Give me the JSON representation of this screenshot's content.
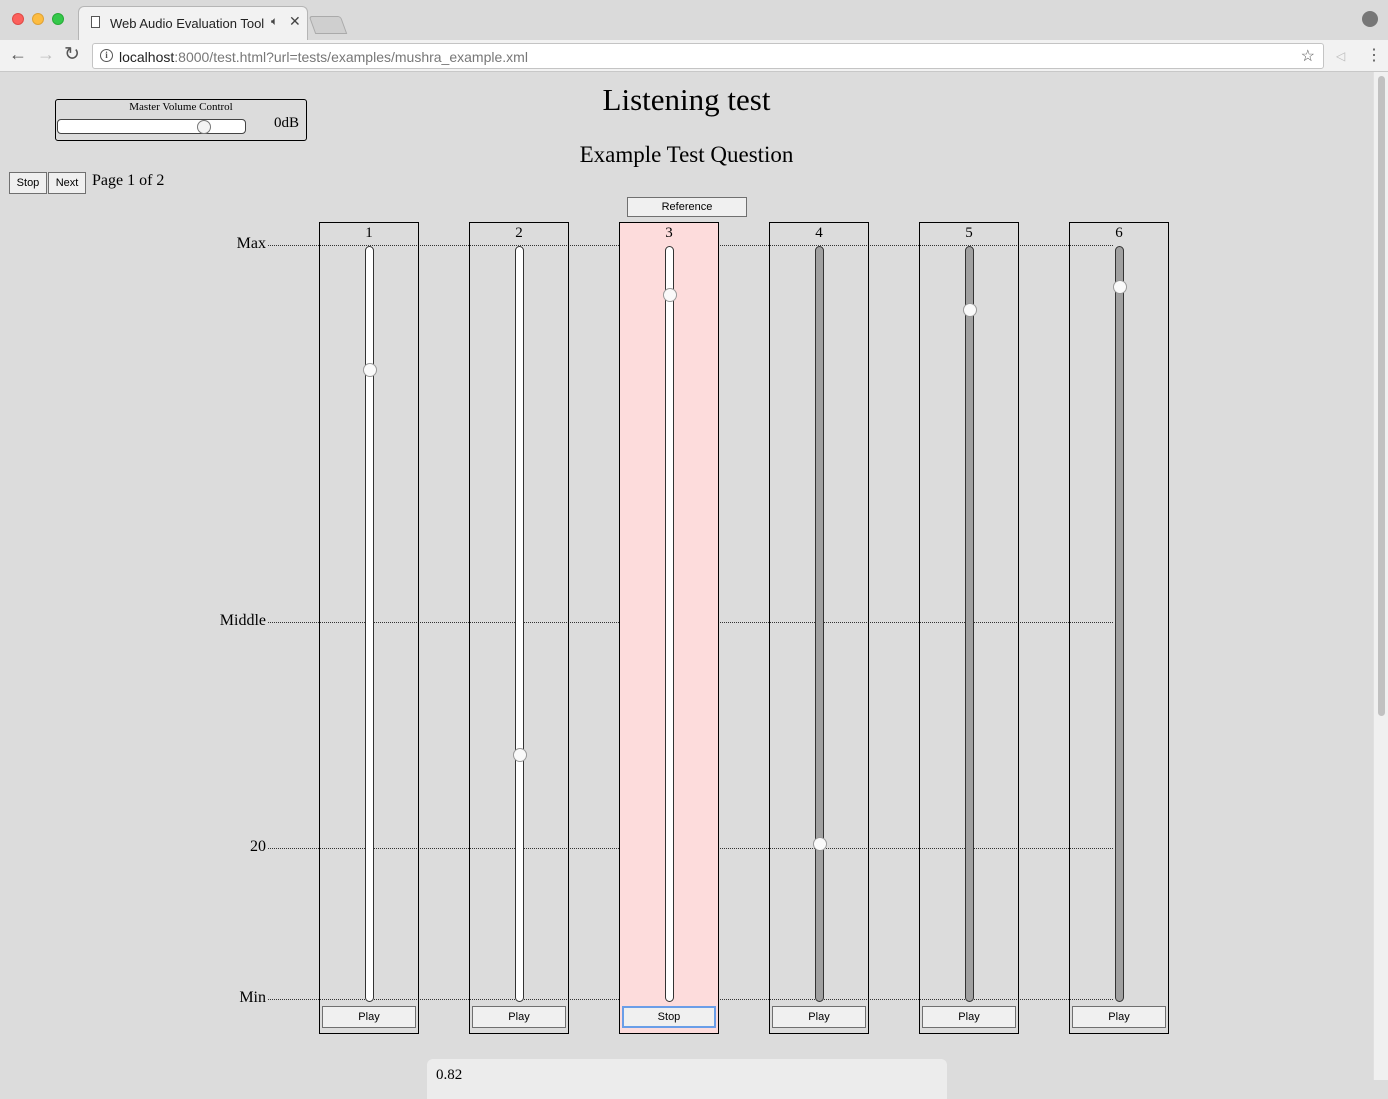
{
  "browser": {
    "tab_title": "Web Audio Evaluation Tool",
    "url_host": "localhost",
    "url_rest": ":8000/test.html?url=tests/examples/mushra_example.xml"
  },
  "volume": {
    "title": "Master Volume Control",
    "value_label": "0dB",
    "level": 0.78
  },
  "page": {
    "title": "Listening test",
    "question": "Example Test Question",
    "stop_label": "Stop",
    "next_label": "Next",
    "page_indicator": "Page 1 of 2",
    "reference_label": "Reference"
  },
  "scale": [
    {
      "label": "Max",
      "position": 1.0
    },
    {
      "label": "Middle",
      "position": 0.5
    },
    {
      "label": "20",
      "position": 0.2
    },
    {
      "label": "Min",
      "position": 0.0
    }
  ],
  "fragments": [
    {
      "label": "1",
      "value": 0.835,
      "button": "Play",
      "active": false,
      "dark_track": false
    },
    {
      "label": "2",
      "value": 0.325,
      "button": "Play",
      "active": false,
      "dark_track": false
    },
    {
      "label": "3",
      "value": 0.935,
      "button": "Stop",
      "active": true,
      "dark_track": false
    },
    {
      "label": "4",
      "value": 0.207,
      "button": "Play",
      "active": false,
      "dark_track": true
    },
    {
      "label": "5",
      "value": 0.915,
      "button": "Play",
      "active": false,
      "dark_track": true
    },
    {
      "label": "6",
      "value": 0.945,
      "button": "Play",
      "active": false,
      "dark_track": true
    }
  ],
  "value_display": "0.82"
}
